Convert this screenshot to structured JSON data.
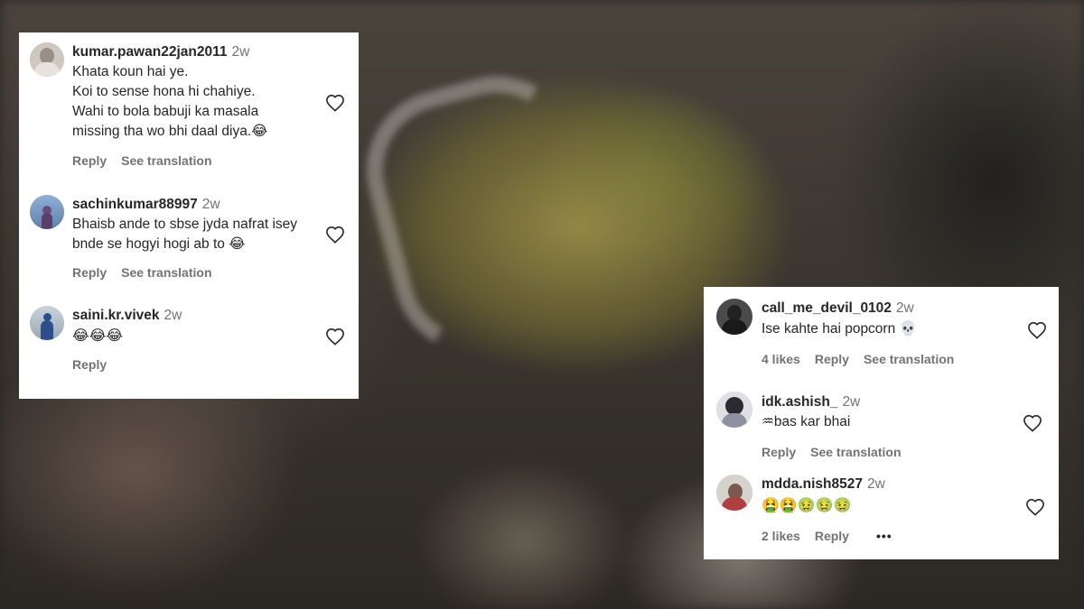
{
  "left_panel": {
    "comments": [
      {
        "username": "kumar.pawan22jan2011",
        "time": "2w",
        "lines": [
          "Khata koun hai ye.",
          "Koi to sense hona hi chahiye.",
          "Wahi to bola babuji ka masala",
          "missing tha wo bhi daal diya.😂"
        ],
        "reply": "Reply",
        "translate": "See translation",
        "avatar_color": "#9a8f86"
      },
      {
        "username": "sachinkumar88997",
        "time": "2w",
        "lines": [
          "Bhaisb ande to sbse jyda nafrat isey",
          "bnde se hogyi hogi ab to 😂"
        ],
        "reply": "Reply",
        "translate": "See translation",
        "avatar_color": "#6f8fb5"
      },
      {
        "username": "saini.kr.vivek",
        "time": "2w",
        "lines": [
          "😂😂😂"
        ],
        "reply": "Reply",
        "avatar_color": "#8aa0b8"
      }
    ]
  },
  "right_panel": {
    "comments": [
      {
        "username": "call_me_devil_0102",
        "time": "2w",
        "lines": [
          "Ise kahte hai popcorn 💀"
        ],
        "likes": "4 likes",
        "reply": "Reply",
        "translate": "See translation",
        "avatar_color": "#3a3a3a"
      },
      {
        "username": "idk.ashish_",
        "time": "2w",
        "lines": [
          "♒bas kar bhai"
        ],
        "reply": "Reply",
        "translate": "See translation",
        "avatar_color": "#7d7d84"
      },
      {
        "username": "mdda.nish8527",
        "time": "2w",
        "lines": [
          "🤮🤮🤢🤢🤢"
        ],
        "likes": "2 likes",
        "reply": "Reply",
        "more": "•••",
        "avatar_color": "#b8b0a8"
      }
    ]
  }
}
